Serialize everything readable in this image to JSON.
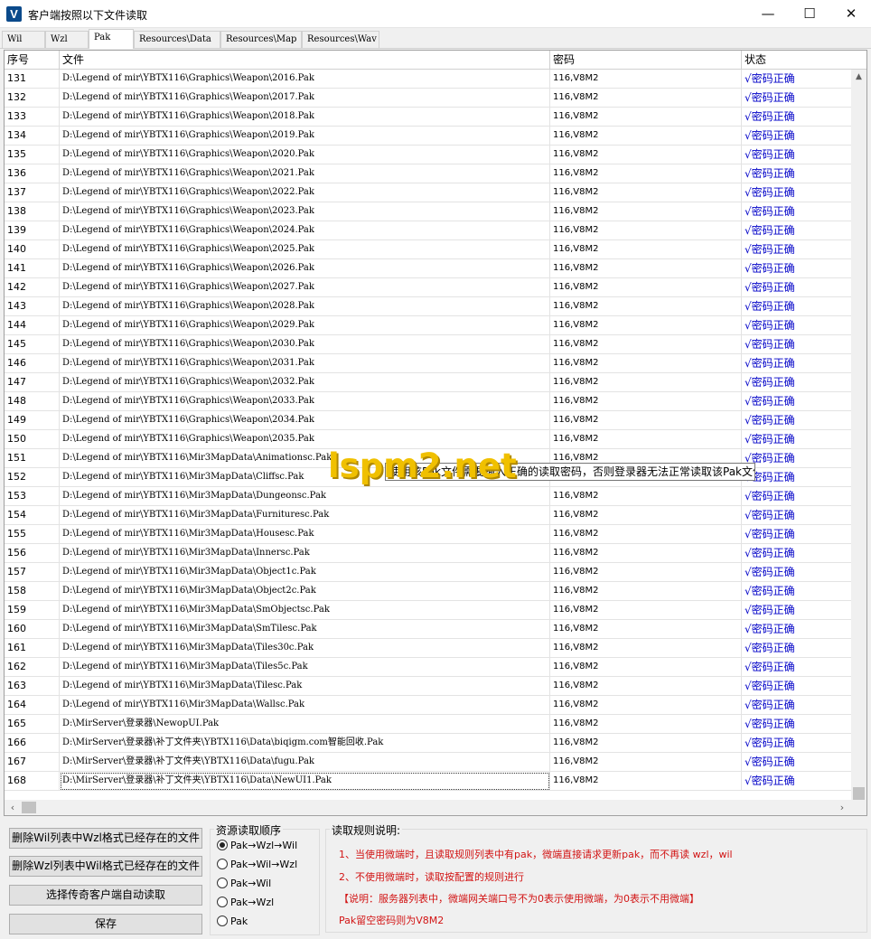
{
  "window": {
    "title": "客户端按照以下文件读取",
    "icon_letter": "V",
    "min_glyph": "—",
    "max_glyph": "☐",
    "close_glyph": "✕"
  },
  "tabs": [
    {
      "label": "Wil",
      "active": false
    },
    {
      "label": "Wzl",
      "active": false
    },
    {
      "label": "Pak",
      "active": true
    },
    {
      "label": "Resources\\Data",
      "active": false
    },
    {
      "label": "Resources\\Map",
      "active": false
    },
    {
      "label": "Resources\\Wav",
      "active": false
    }
  ],
  "table": {
    "columns": [
      "序号",
      "文件",
      "密码",
      "状态"
    ],
    "status_check": "√",
    "rows": [
      {
        "id": "131",
        "file": "D:\\Legend of mir\\YBTX116\\Graphics\\Weapon\\2016.Pak",
        "pwd": "116,V8M2",
        "status": "密码正确"
      },
      {
        "id": "132",
        "file": "D:\\Legend of mir\\YBTX116\\Graphics\\Weapon\\2017.Pak",
        "pwd": "116,V8M2",
        "status": "密码正确"
      },
      {
        "id": "133",
        "file": "D:\\Legend of mir\\YBTX116\\Graphics\\Weapon\\2018.Pak",
        "pwd": "116,V8M2",
        "status": "密码正确"
      },
      {
        "id": "134",
        "file": "D:\\Legend of mir\\YBTX116\\Graphics\\Weapon\\2019.Pak",
        "pwd": "116,V8M2",
        "status": "密码正确"
      },
      {
        "id": "135",
        "file": "D:\\Legend of mir\\YBTX116\\Graphics\\Weapon\\2020.Pak",
        "pwd": "116,V8M2",
        "status": "密码正确"
      },
      {
        "id": "136",
        "file": "D:\\Legend of mir\\YBTX116\\Graphics\\Weapon\\2021.Pak",
        "pwd": "116,V8M2",
        "status": "密码正确"
      },
      {
        "id": "137",
        "file": "D:\\Legend of mir\\YBTX116\\Graphics\\Weapon\\2022.Pak",
        "pwd": "116,V8M2",
        "status": "密码正确"
      },
      {
        "id": "138",
        "file": "D:\\Legend of mir\\YBTX116\\Graphics\\Weapon\\2023.Pak",
        "pwd": "116,V8M2",
        "status": "密码正确"
      },
      {
        "id": "139",
        "file": "D:\\Legend of mir\\YBTX116\\Graphics\\Weapon\\2024.Pak",
        "pwd": "116,V8M2",
        "status": "密码正确"
      },
      {
        "id": "140",
        "file": "D:\\Legend of mir\\YBTX116\\Graphics\\Weapon\\2025.Pak",
        "pwd": "116,V8M2",
        "status": "密码正确"
      },
      {
        "id": "141",
        "file": "D:\\Legend of mir\\YBTX116\\Graphics\\Weapon\\2026.Pak",
        "pwd": "116,V8M2",
        "status": "密码正确"
      },
      {
        "id": "142",
        "file": "D:\\Legend of mir\\YBTX116\\Graphics\\Weapon\\2027.Pak",
        "pwd": "116,V8M2",
        "status": "密码正确"
      },
      {
        "id": "143",
        "file": "D:\\Legend of mir\\YBTX116\\Graphics\\Weapon\\2028.Pak",
        "pwd": "116,V8M2",
        "status": "密码正确"
      },
      {
        "id": "144",
        "file": "D:\\Legend of mir\\YBTX116\\Graphics\\Weapon\\2029.Pak",
        "pwd": "116,V8M2",
        "status": "密码正确"
      },
      {
        "id": "145",
        "file": "D:\\Legend of mir\\YBTX116\\Graphics\\Weapon\\2030.Pak",
        "pwd": "116,V8M2",
        "status": "密码正确"
      },
      {
        "id": "146",
        "file": "D:\\Legend of mir\\YBTX116\\Graphics\\Weapon\\2031.Pak",
        "pwd": "116,V8M2",
        "status": "密码正确"
      },
      {
        "id": "147",
        "file": "D:\\Legend of mir\\YBTX116\\Graphics\\Weapon\\2032.Pak",
        "pwd": "116,V8M2",
        "status": "密码正确"
      },
      {
        "id": "148",
        "file": "D:\\Legend of mir\\YBTX116\\Graphics\\Weapon\\2033.Pak",
        "pwd": "116,V8M2",
        "status": "密码正确"
      },
      {
        "id": "149",
        "file": "D:\\Legend of mir\\YBTX116\\Graphics\\Weapon\\2034.Pak",
        "pwd": "116,V8M2",
        "status": "密码正确"
      },
      {
        "id": "150",
        "file": "D:\\Legend of mir\\YBTX116\\Graphics\\Weapon\\2035.Pak",
        "pwd": "116,V8M2",
        "status": "密码正确"
      },
      {
        "id": "151",
        "file": "D:\\Legend of mir\\YBTX116\\Mir3MapData\\Animationsc.Pak",
        "pwd": "116,V8M2",
        "status": "密码正确"
      },
      {
        "id": "152",
        "file": "D:\\Legend of mir\\YBTX116\\Mir3MapData\\Cliffsc.Pak",
        "pwd": "116,V8M2",
        "status": "密码正确"
      },
      {
        "id": "153",
        "file": "D:\\Legend of mir\\YBTX116\\Mir3MapData\\Dungeonsc.Pak",
        "pwd": "116,V8M2",
        "status": "密码正确"
      },
      {
        "id": "154",
        "file": "D:\\Legend of mir\\YBTX116\\Mir3MapData\\Furnituresc.Pak",
        "pwd": "116,V8M2",
        "status": "密码正确"
      },
      {
        "id": "155",
        "file": "D:\\Legend of mir\\YBTX116\\Mir3MapData\\Housesc.Pak",
        "pwd": "116,V8M2",
        "status": "密码正确"
      },
      {
        "id": "156",
        "file": "D:\\Legend of mir\\YBTX116\\Mir3MapData\\Innersc.Pak",
        "pwd": "116,V8M2",
        "status": "密码正确"
      },
      {
        "id": "157",
        "file": "D:\\Legend of mir\\YBTX116\\Mir3MapData\\Object1c.Pak",
        "pwd": "116,V8M2",
        "status": "密码正确"
      },
      {
        "id": "158",
        "file": "D:\\Legend of mir\\YBTX116\\Mir3MapData\\Object2c.Pak",
        "pwd": "116,V8M2",
        "status": "密码正确"
      },
      {
        "id": "159",
        "file": "D:\\Legend of mir\\YBTX116\\Mir3MapData\\SmObjectsc.Pak",
        "pwd": "116,V8M2",
        "status": "密码正确"
      },
      {
        "id": "160",
        "file": "D:\\Legend of mir\\YBTX116\\Mir3MapData\\SmTilesc.Pak",
        "pwd": "116,V8M2",
        "status": "密码正确"
      },
      {
        "id": "161",
        "file": "D:\\Legend of mir\\YBTX116\\Mir3MapData\\Tiles30c.Pak",
        "pwd": "116,V8M2",
        "status": "密码正确"
      },
      {
        "id": "162",
        "file": "D:\\Legend of mir\\YBTX116\\Mir3MapData\\Tiles5c.Pak",
        "pwd": "116,V8M2",
        "status": "密码正确"
      },
      {
        "id": "163",
        "file": "D:\\Legend of mir\\YBTX116\\Mir3MapData\\Tilesc.Pak",
        "pwd": "116,V8M2",
        "status": "密码正确"
      },
      {
        "id": "164",
        "file": "D:\\Legend of mir\\YBTX116\\Mir3MapData\\Wallsc.Pak",
        "pwd": "116,V8M2",
        "status": "密码正确"
      },
      {
        "id": "165",
        "file": "D:\\MirServer\\登录器\\NewopUI.Pak",
        "pwd": "116,V8M2",
        "status": "密码正确"
      },
      {
        "id": "166",
        "file": "D:\\MirServer\\登录器\\补丁文件夹\\YBTX116\\Data\\biqigm.com智能回收.Pak",
        "pwd": "116,V8M2",
        "status": "密码正确"
      },
      {
        "id": "167",
        "file": "D:\\MirServer\\登录器\\补丁文件夹\\YBTX116\\Data\\fugu.Pak",
        "pwd": "116,V8M2",
        "status": "密码正确"
      },
      {
        "id": "168",
        "file": "D:\\MirServer\\登录器\\补丁文件夹\\YBTX116\\Data\\NewUI1.Pak",
        "pwd": "116,V8M2",
        "status": "密码正确",
        "selected": true
      }
    ]
  },
  "tooltip": "使用该Pak文件需要输入正确的读取密码，否则登录器无法正常读取该Pak文件",
  "watermark": "lspm2.net",
  "scroll": {
    "up": "▲",
    "down": "▼",
    "left": "‹",
    "right": "›"
  },
  "buttons": {
    "delete_wil": "删除Wil列表中Wzl格式已经存在的文件",
    "delete_wzl": "删除Wzl列表中Wil格式已经存在的文件",
    "auto_read": "选择传奇客户端自动读取",
    "save": "保存"
  },
  "read_order": {
    "legend": "资源读取顺序",
    "options": [
      {
        "label": "Pak→Wzl→Wil",
        "checked": true
      },
      {
        "label": "Pak→Wil→Wzl",
        "checked": false
      },
      {
        "label": "Pak→Wil",
        "checked": false
      },
      {
        "label": "Pak→Wzl",
        "checked": false
      },
      {
        "label": "Pak",
        "checked": false
      }
    ]
  },
  "rules": {
    "legend": "读取规则说明:",
    "lines": [
      "1、当使用微端时，且读取规则列表中有pak，微端直接请求更新pak，而不再读 wzl，wil",
      "2、不使用微端时，读取按配置的规则进行",
      "【说明：服务器列表中，微端网关端口号不为0表示使用微端，为0表示不用微端】",
      "Pak留空密码则为V8M2"
    ]
  },
  "colors": {
    "status_text": "#0000c8",
    "rules_text": "#d21414",
    "watermark": "#f0c000"
  }
}
